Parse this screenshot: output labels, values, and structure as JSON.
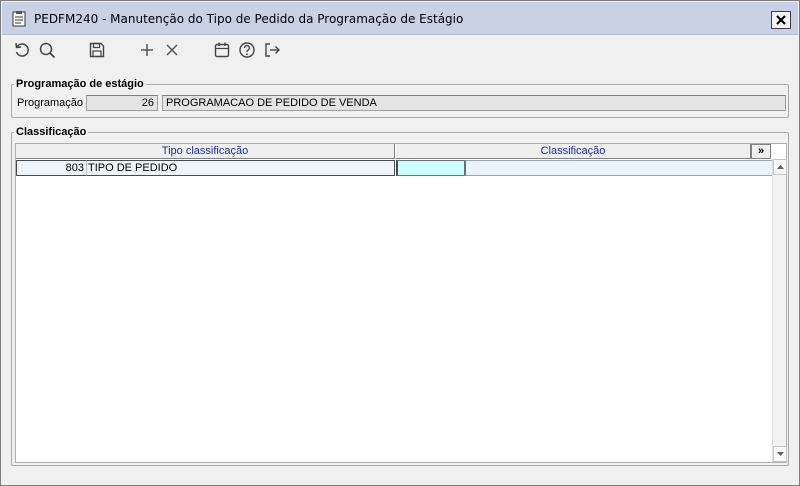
{
  "window": {
    "title": "PEDFM240 - Manutenção do Tipo de Pedido da Programação de Estágio",
    "close_label": "✕"
  },
  "toolbar": {
    "buttons": [
      {
        "name": "refresh-icon"
      },
      {
        "name": "search-icon"
      },
      {
        "name": "save-icon"
      },
      {
        "name": "add-icon"
      },
      {
        "name": "delete-icon"
      },
      {
        "name": "calendar-icon"
      },
      {
        "name": "help-icon"
      },
      {
        "name": "exit-icon"
      }
    ]
  },
  "programacao_group": {
    "legend": "Programação de estágio",
    "label": "Programação",
    "code": "26",
    "description": "PROGRAMACAO DE PEDIDO DE VENDA"
  },
  "classificacao_group": {
    "legend": "Classificação",
    "columns": [
      "Tipo classificação",
      "Classificação"
    ],
    "more_label": "»",
    "rows": [
      {
        "tipo_code": "803",
        "tipo_name": "TIPO DE PEDIDO",
        "class_code": "",
        "class_name": ""
      }
    ]
  },
  "colors": {
    "titlebar": "#c9d1e6",
    "header_text": "#1b2d9e",
    "active_cell": "#ccffff"
  }
}
